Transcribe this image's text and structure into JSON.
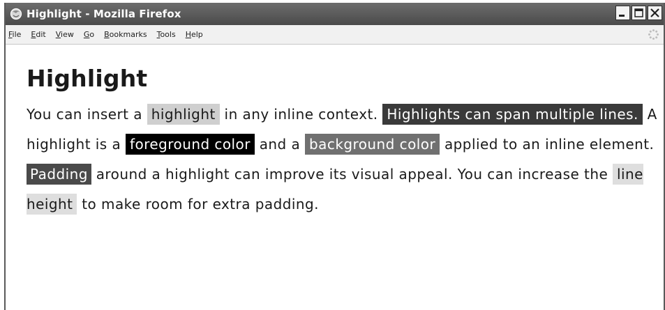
{
  "window": {
    "title": "Highlight - Mozilla Firefox"
  },
  "menu": {
    "items": [
      "File",
      "Edit",
      "View",
      "Go",
      "Bookmarks",
      "Tools",
      "Help"
    ],
    "mnemonic_first": [
      "F",
      "E",
      "V",
      "G",
      "B",
      "T",
      "H"
    ],
    "mnemonic_rest": [
      "ile",
      "dit",
      "iew",
      "o",
      "ookmarks",
      "ools",
      "elp"
    ]
  },
  "page": {
    "heading": "Highlight",
    "paragraph": {
      "t1": "You can insert a ",
      "h1": "highlight",
      "t2": " in any inline context. ",
      "h2": "Highlights can span multiple lines.",
      "t3": " A highlight is a ",
      "h3": "foreground color",
      "t4": " and a ",
      "h4": "background color",
      "t5": " applied to an inline element. ",
      "h5": "Padding",
      "t6": " around a highlight can improve its visual appeal. You can increase the ",
      "h6": "line height",
      "t7": " to make room for extra padding."
    }
  },
  "icons": {
    "app": "firefox-logo-icon",
    "minimize": "minimize-icon",
    "maximize": "maximize-icon",
    "close": "close-icon",
    "throbber": "throbber-icon"
  },
  "colors": {
    "titlebar": "#4a4a4a",
    "menubar": "#f1f1f1",
    "highlight_light": "#cfcfcf",
    "highlight_dark": "#3a3a3a",
    "highlight_black": "#000000",
    "highlight_mid": "#707070"
  }
}
